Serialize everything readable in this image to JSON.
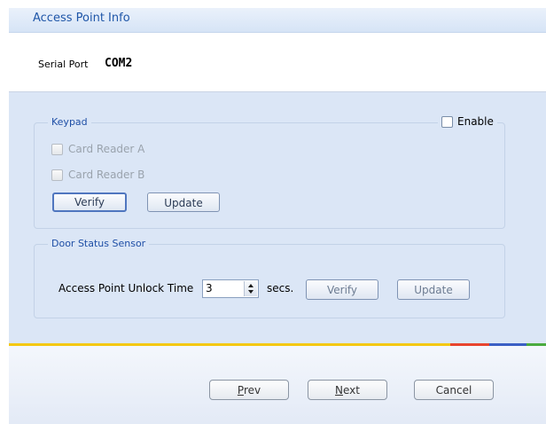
{
  "header": {
    "title": "Access Point Info"
  },
  "serial": {
    "label": "Serial Port",
    "value": "COM2"
  },
  "keypad": {
    "title": "Keypad",
    "enable_label": "Enable",
    "readers": [
      "Card Reader A",
      "Card Reader B"
    ],
    "verify_label": "Verify",
    "update_label": "Update"
  },
  "door": {
    "title": "Door Status Sensor",
    "unlock_label": "Access Point Unlock Time",
    "unlock_value": "3",
    "unit_label": "secs.",
    "verify_label": "Verify",
    "update_label": "Update"
  },
  "footer": {
    "prev_prefix": "P",
    "prev_rest": "rev",
    "next_prefix": "N",
    "next_rest": "ext",
    "cancel_label": "Cancel"
  },
  "colors": {
    "accent": "#1f56a8",
    "stripe": [
      "#f4c810",
      "#e8442e",
      "#3b5fc4",
      "#4bab3f"
    ]
  }
}
